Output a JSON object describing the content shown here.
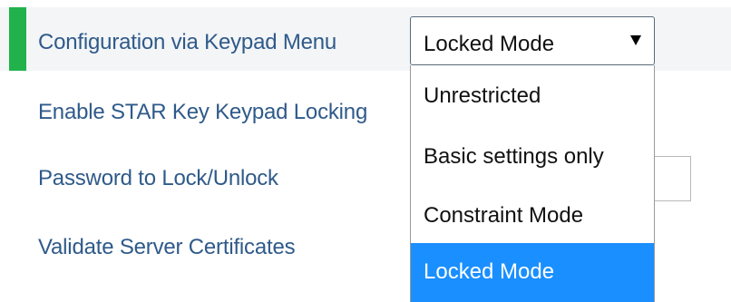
{
  "form": {
    "rows": [
      {
        "label": "Configuration via Keypad Menu"
      },
      {
        "label": "Enable STAR Key Keypad Locking"
      },
      {
        "label": "Password to Lock/Unlock"
      },
      {
        "label": "Validate Server Certificates"
      }
    ],
    "accent_color": "#21b24b"
  },
  "keypad_menu_select": {
    "selected": "Locked Mode",
    "options": [
      {
        "label": "Unrestricted"
      },
      {
        "label": "Basic settings only"
      },
      {
        "label": "Constraint Mode"
      },
      {
        "label": "Locked Mode"
      }
    ],
    "highlight_color": "#1a8fff"
  }
}
